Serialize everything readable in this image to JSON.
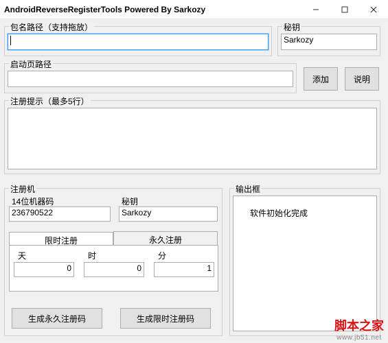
{
  "window": {
    "title": "AndroidReverseRegisterTools     Powered By Sarkozy"
  },
  "groups": {
    "pkg_path_label": "包名路径（支持拖放）",
    "secret_label": "秘钥",
    "start_path_label": "启动页路径",
    "register_hint_label": "注册提示（最多5行）",
    "register_machine_label": "注册机",
    "output_label": "输出框"
  },
  "fields": {
    "pkg_path_value": "",
    "secret_value": "Sarkozy",
    "start_path_value": "",
    "register_hint_value": "",
    "machine_code_label": "14位机器码",
    "machine_code_value": "236790522",
    "rm_secret_label": "秘钥",
    "rm_secret_value": "Sarkozy",
    "days_label": "天",
    "days_value": "0",
    "hours_label": "时",
    "hours_value": "0",
    "minutes_label": "分",
    "minutes_value": "1",
    "output_value": "软件初始化完成"
  },
  "buttons": {
    "add": "添加",
    "explain": "说明",
    "gen_perm": "生成永久注册码",
    "gen_limited": "生成限时注册码"
  },
  "tabs": {
    "limited": "限时注册",
    "permanent": "永久注册"
  },
  "watermark": {
    "main": "脚本之家",
    "sub": "www.jb51.net"
  }
}
